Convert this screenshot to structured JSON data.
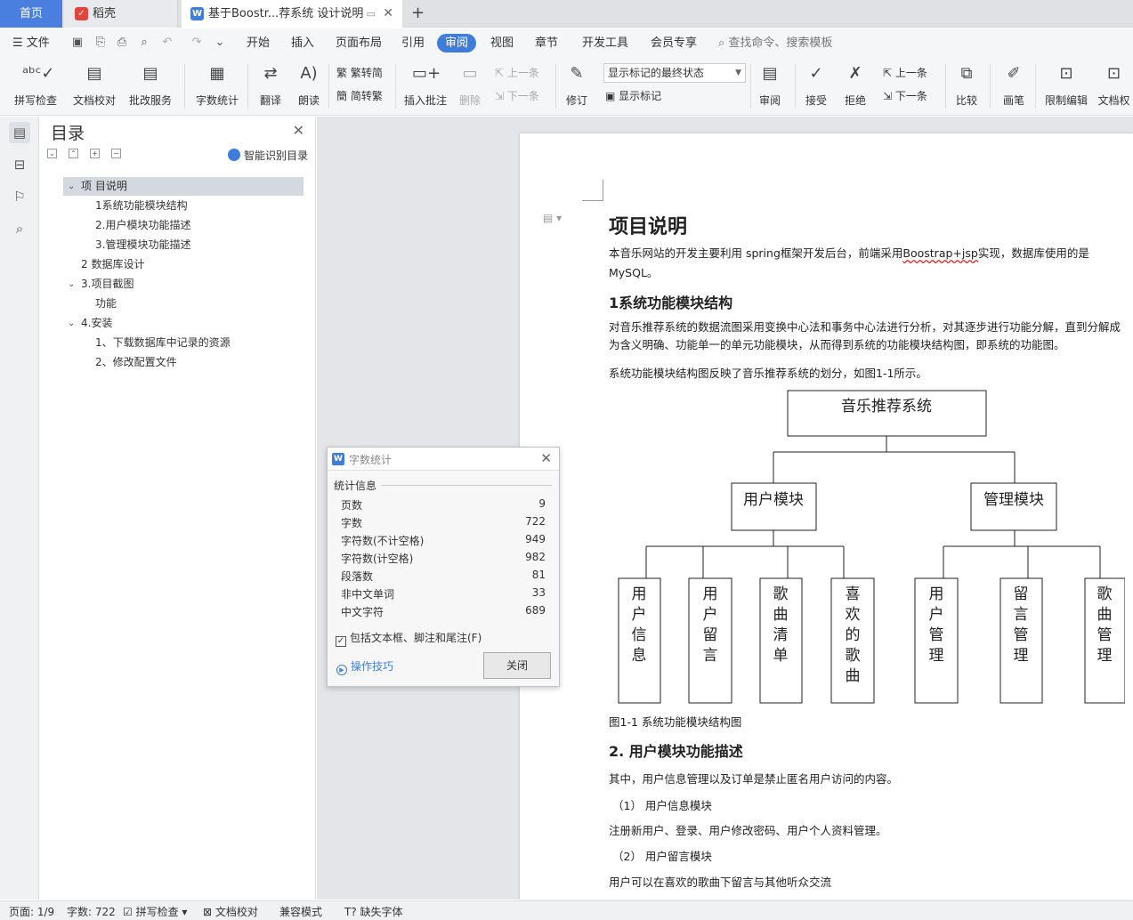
{
  "tabs": {
    "home": "首页",
    "daoke": "稻壳",
    "daoke_icon": "daoke-icon",
    "doc": "基于Boostr...荐系统 设计说明",
    "doc_icon": "W",
    "new_tab": "+"
  },
  "menu": {
    "file": "文件",
    "items": [
      "开始",
      "插入",
      "页面布局",
      "引用",
      "审阅",
      "视图",
      "章节",
      "开发工具",
      "会员专享"
    ],
    "active": "审阅",
    "search": "查找命令、搜索模板"
  },
  "ribbon": {
    "spell": "拼写检查",
    "proof": "文档校对",
    "review_service": "批改服务",
    "word_count": "字数统计",
    "translate": "翻译",
    "read_aloud": "朗读",
    "trad_conv": "繁转简",
    "simp_conv": "简转繁",
    "insert_comment": "插入批注",
    "delete": "删除",
    "prev_comment": "上一条",
    "next_comment": "下一条",
    "track": "修订",
    "markup_state": "显示标记的最终状态",
    "show_markup": "显示标记",
    "review": "审阅",
    "accept": "接受",
    "reject": "拒绝",
    "prev_change": "上一条",
    "next_change": "下一条",
    "compare": "比较",
    "pen": "画笔",
    "restrict": "限制编辑",
    "doc_perm": "文档权"
  },
  "toc": {
    "title": "目录",
    "smart": "智能识别目录",
    "items": [
      "项 目说明",
      "1系统功能模块结构",
      "2.用户模块功能描述",
      "3.管理模块功能描述",
      "2 数据库设计",
      "3.项目截图",
      "功能",
      "4.安装",
      "1、下载数据库中记录的资源",
      "2、修改配置文件"
    ]
  },
  "document": {
    "h1": "项目说明",
    "intro_a": "本音乐网站的开发主要利用 spring框架开发后台，前端采用",
    "intro_b": "Boostrap+jsp",
    "intro_c": "实现，数据库使用的是 MySQL。",
    "h2_1": "1系统功能模块结构",
    "p1": "对音乐推荐系统的数据流图采用变换中心法和事务中心法进行分析，对其逐步进行功能分解，直到分解成为含义明确、功能单一的单元功能模块，从而得到系统的功能模块结构图，即系统的功能图。",
    "p2": "系统功能模块结构图反映了音乐推荐系统的划分，如图1-1所示。",
    "figure": {
      "root": "音乐推荐系统",
      "left": "用户模块",
      "right": "管理模块",
      "leaves": [
        "用户信息",
        "用户留言",
        "歌曲清单",
        "喜欢的歌曲",
        "用户管理",
        "留言管理",
        "歌曲管理"
      ]
    },
    "caption": "图1-1  系统功能模块结构图",
    "h2_2": "2.  用户模块功能描述",
    "p3": "其中，用户信息管理以及订单是禁止匿名用户访问的内容。",
    "li1": "（1）  用户信息模块",
    "p4": "注册新用户、登录、用户修改密码、用户个人资料管理。",
    "li2": "（2）  用户留言模块",
    "p5": "用户可以在喜欢的歌曲下留言与其他听众交流"
  },
  "dialog": {
    "title": "字数统计",
    "section": "统计信息",
    "rows": [
      {
        "label": "页数",
        "value": "9"
      },
      {
        "label": "字数",
        "value": "722"
      },
      {
        "label": "字符数(不计空格)",
        "value": "949"
      },
      {
        "label": "字符数(计空格)",
        "value": "982"
      },
      {
        "label": "段落数",
        "value": "81"
      },
      {
        "label": "非中文单词",
        "value": "33"
      },
      {
        "label": "中文字符",
        "value": "689"
      }
    ],
    "checkbox": "包括文本框、脚注和尾注(F)",
    "checked": true,
    "tips": "操作技巧",
    "close": "关闭"
  },
  "status": {
    "page": "页面: 1/9",
    "words": "字数: 722",
    "spell": "拼写检查",
    "proof": "文档校对",
    "compat": "兼容模式",
    "missing_font": "缺失字体"
  },
  "colors": {
    "accent": "#3e7ddb",
    "daoke": "#e0443a"
  }
}
